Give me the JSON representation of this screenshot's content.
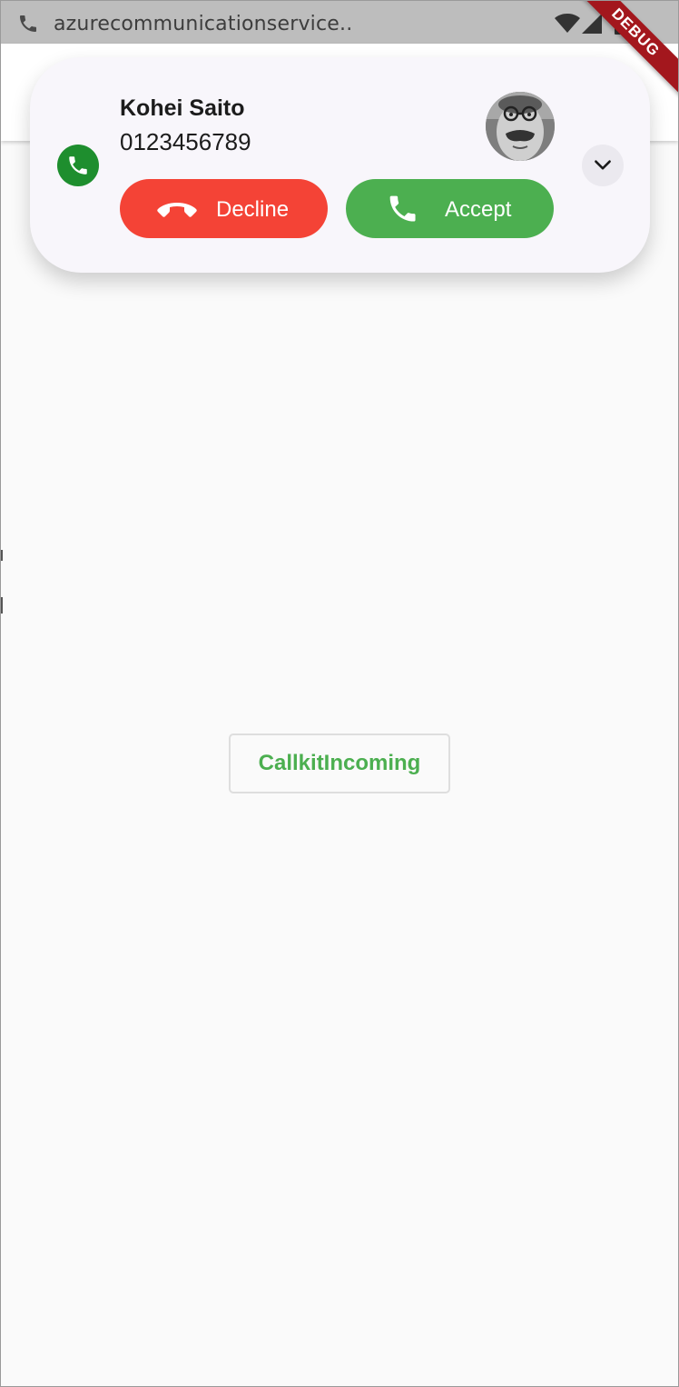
{
  "status_bar": {
    "notification_title": "azurecommunicationservice..",
    "app_icon": "phone-icon",
    "wifi_icon": "wifi-icon",
    "signal_icon": "cell-signal-icon",
    "battery_icon": "battery-icon"
  },
  "debug_banner": {
    "label": "DEBUG",
    "color": "#a3171d"
  },
  "incoming_call": {
    "caller_name": "Kohei Saito",
    "caller_number": "0123456789",
    "badge_icon": "phone-icon",
    "expand_icon": "chevron-down-icon",
    "decline_label": "Decline",
    "decline_icon": "hang-up-icon",
    "decline_color": "#f44336",
    "accept_label": "Accept",
    "accept_icon": "phone-icon",
    "accept_color": "#4caf50",
    "badge_color": "#1e8e2e"
  },
  "main": {
    "callkit_button_label": "CallkitIncoming",
    "callkit_button_color": "#4caf50"
  }
}
